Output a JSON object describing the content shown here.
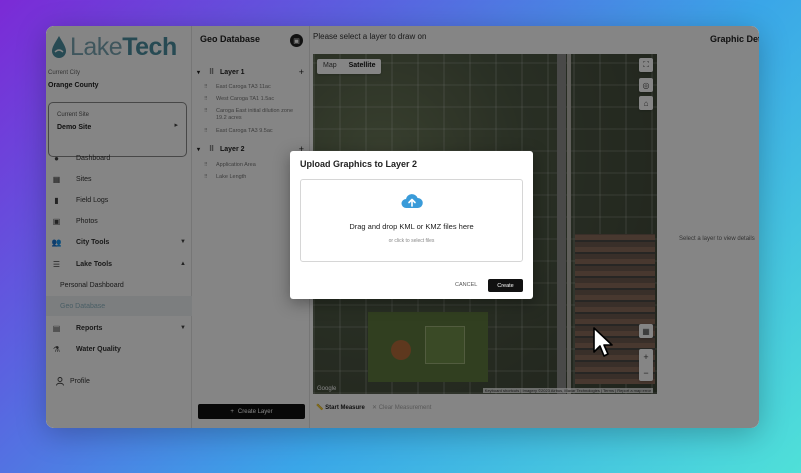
{
  "brand": {
    "logo_part1": "Lake",
    "logo_part2": "Tech",
    "logo_color": "#4b8ea0"
  },
  "sidebar": {
    "current_city_label": "Current City",
    "current_city": "Orange County",
    "current_site_label": "Current Site",
    "current_site": "Demo Site",
    "items": [
      {
        "label": "Dashboard",
        "icon": "info-icon"
      },
      {
        "label": "Sites",
        "icon": "sites-icon"
      },
      {
        "label": "Field Logs",
        "icon": "document-icon"
      },
      {
        "label": "Photos",
        "icon": "photo-icon"
      },
      {
        "label": "City Tools",
        "icon": "people-icon"
      },
      {
        "label": "Lake Tools",
        "icon": "list-icon"
      },
      {
        "label": "Personal Dashboard"
      },
      {
        "label": "Geo Database"
      },
      {
        "label": "Reports",
        "icon": "reports-icon"
      },
      {
        "label": "Water Quality",
        "icon": "water-quality-icon"
      }
    ],
    "profile_label": "Profile"
  },
  "geo": {
    "title": "Geo Database",
    "layers": [
      {
        "name": "Layer 1",
        "items": [
          "East Caroga TA3 11ac",
          "West Caroga TA1 1.5ac",
          "Caroga East initial dilution zone 19.2 acres",
          "East Caroga TA3 9.5ac"
        ]
      },
      {
        "name": "Layer 2",
        "items": [
          "Application Area",
          "Lake Length"
        ]
      }
    ],
    "create_layer_label": "Create Layer"
  },
  "map": {
    "prompt": "Please select a layer to draw on",
    "view_map": "Map",
    "view_satellite": "Satellite",
    "google_label": "Google",
    "attribution": "Keyboard shortcuts | Imagery ©2023 Airbus, Maxar Technologies | Terms | Report a map error",
    "start_measure": "Start Measure",
    "clear_measure": "Clear Measurement"
  },
  "details": {
    "title": "Graphic Details",
    "empty_text": "Select a layer to view details"
  },
  "modal": {
    "title": "Upload Graphics to Layer 2",
    "drop_main": "Drag and drop KML or KMZ files here",
    "drop_sub": "or click to select files",
    "cancel_label": "CANCEL",
    "create_label": "Create",
    "upload_icon_color": "#3a9bd9"
  }
}
